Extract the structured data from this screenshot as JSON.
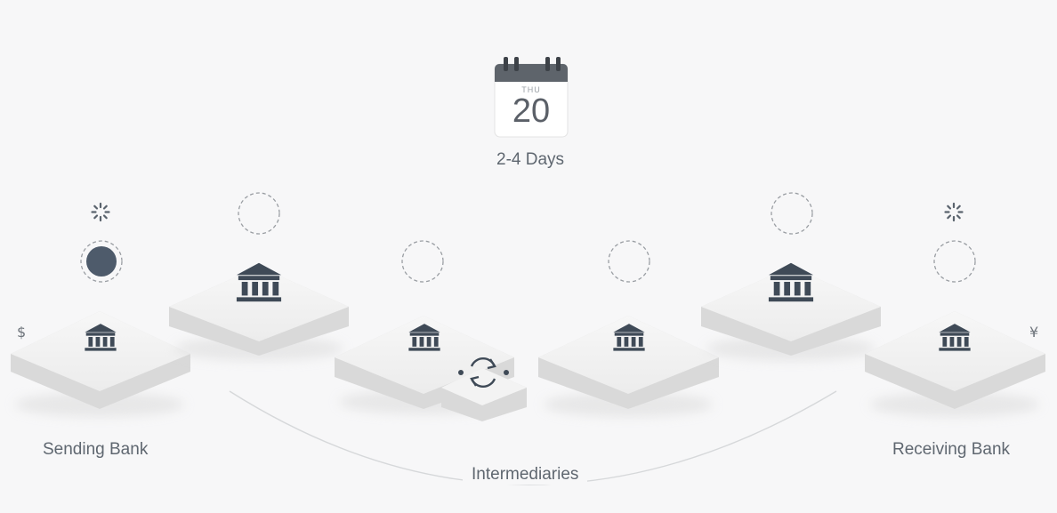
{
  "calendar": {
    "day_of_week": "THU",
    "date": "20"
  },
  "duration_label": "2-4 Days",
  "banks": {
    "sending_label": "Sending Bank",
    "receiving_label": "Receiving Bank",
    "intermediaries_label": "Intermediaries"
  },
  "currencies": {
    "send_symbol": "$",
    "receive_symbol": "¥"
  },
  "colors": {
    "icon": "#3f4a57",
    "slab_top": "#f2f2f2",
    "slab_side": "#dcdcdc",
    "dashed": "#9a9ea3",
    "filled_dot": "#4e5b6b"
  }
}
